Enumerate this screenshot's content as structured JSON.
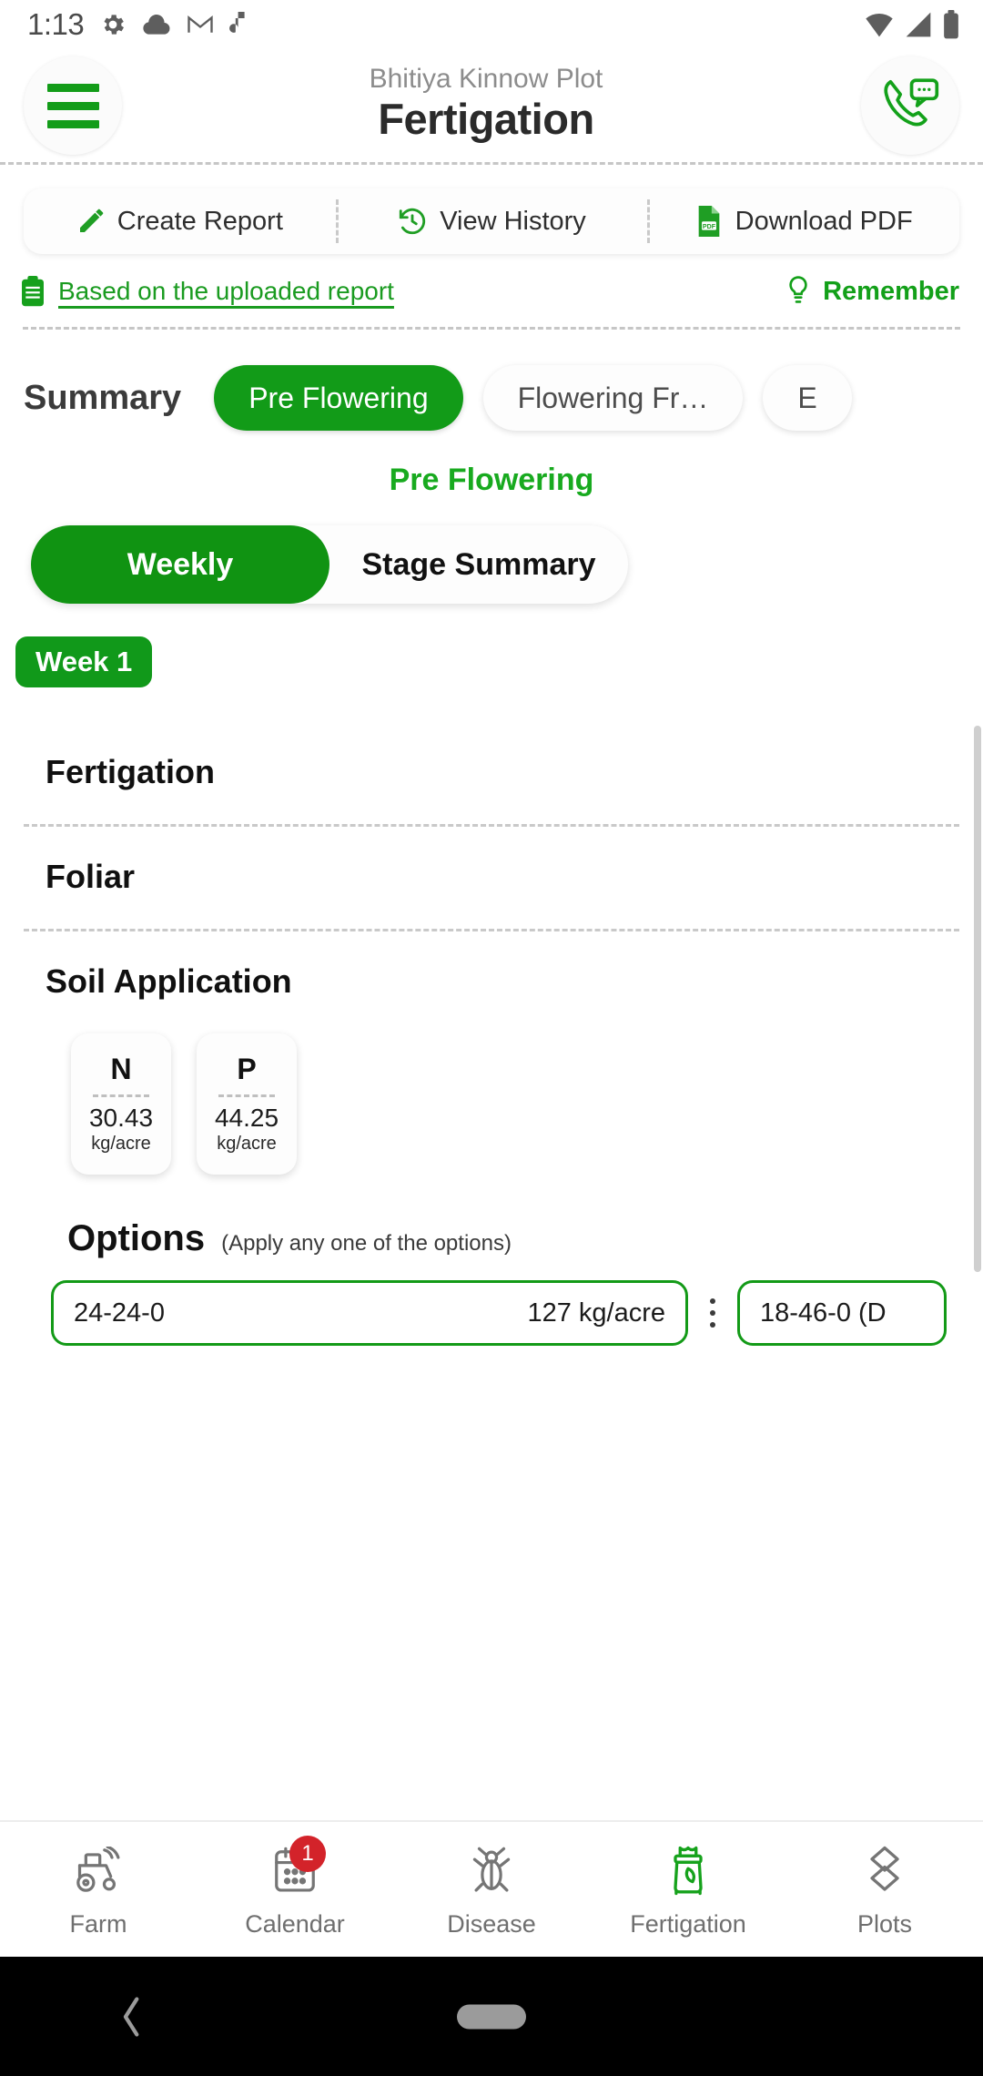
{
  "status_bar": {
    "time": "1:13",
    "left_icons": [
      "gear-icon",
      "cloud-icon",
      "gmail-icon",
      "music-note-icon"
    ],
    "right_icons": [
      "wifi-icon",
      "signal-icon",
      "battery-icon"
    ]
  },
  "header": {
    "menu_icon": "hamburger-menu-icon",
    "plot_name": "Bhitiya Kinnow Plot",
    "title": "Fertigation",
    "call_icon": "phone-chat-icon"
  },
  "action_bar": {
    "items": [
      {
        "label": "Create Report",
        "icon": "pencil-icon"
      },
      {
        "label": "View History",
        "icon": "history-clock-icon"
      },
      {
        "label": "Download PDF",
        "icon": "pdf-file-icon"
      }
    ]
  },
  "report_strip": {
    "link_icon": "clipboard-icon",
    "link_label": "Based on the uploaded report",
    "remember_icon": "lightbulb-icon",
    "remember_label": "Remember"
  },
  "summary": {
    "label": "Summary",
    "tabs": [
      {
        "label": "Pre Flowering",
        "active": true
      },
      {
        "label": "Flowering Fr…",
        "active": false
      },
      {
        "label": "E",
        "active": false
      }
    ]
  },
  "stage": {
    "heading": "Pre Flowering",
    "view_toggle": [
      {
        "label": "Weekly",
        "active": true
      },
      {
        "label": "Stage Summary",
        "active": false
      }
    ],
    "week_chip": "Week 1"
  },
  "detail": {
    "sections": [
      {
        "title": "Fertigation"
      },
      {
        "title": "Foliar"
      },
      {
        "title": "Soil Application"
      }
    ],
    "nutrients": [
      {
        "symbol": "N",
        "value": "30.43",
        "unit": "kg/acre"
      },
      {
        "symbol": "P",
        "value": "44.25",
        "unit": "kg/acre"
      }
    ],
    "options": {
      "title": "Options",
      "hint": "(Apply any one of the options)",
      "kebab_icon": "more-vertical-icon",
      "items": [
        {
          "name": "24-24-0",
          "qty": "127 kg/acre"
        },
        {
          "name": "18-46-0 (D",
          "qty": ""
        }
      ]
    }
  },
  "bottom_nav": {
    "items": [
      {
        "label": "Farm",
        "icon": "tractor-icon",
        "badge": "",
        "active": false
      },
      {
        "label": "Calendar",
        "icon": "calendar-icon",
        "badge": "1",
        "active": false
      },
      {
        "label": "Disease",
        "icon": "insect-icon",
        "badge": "",
        "active": false
      },
      {
        "label": "Fertigation",
        "icon": "fertilizer-bag-icon",
        "badge": "",
        "active": true
      },
      {
        "label": "Plots",
        "icon": "layers-icon",
        "badge": "",
        "active": false
      }
    ]
  },
  "system_nav": {
    "back_icon": "back-chevron-icon",
    "home_icon": "home-pill-icon"
  },
  "colors": {
    "brand_green": "#139a17",
    "badge_red": "#d3232a",
    "muted_text": "#8c8c8c"
  }
}
